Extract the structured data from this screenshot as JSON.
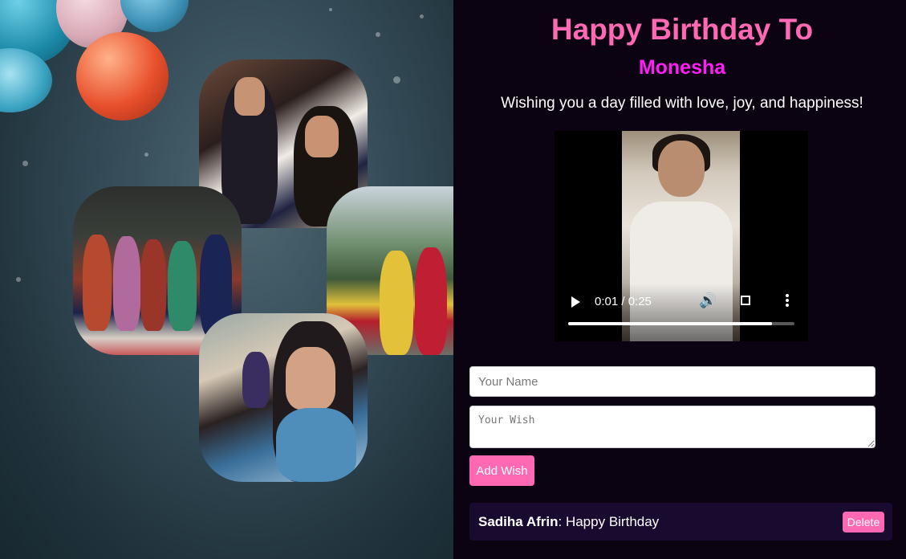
{
  "header": {
    "title": "Happy Birthday To",
    "name": "Monesha",
    "message": "Wishing you a day filled with love, joy, and happiness!"
  },
  "video": {
    "time": "0:01 / 0:25",
    "progress": 0.9
  },
  "form": {
    "name_placeholder": "Your Name",
    "wish_placeholder": "Your Wish",
    "add_label": "Add Wish"
  },
  "wishes": [
    {
      "author": "Sadiha Afrin",
      "text": "Happy Birthday",
      "delete_label": "Delete"
    }
  ],
  "colors": {
    "accent": "#ff69b4",
    "name": "#ff1ff6",
    "background": "#0c0312",
    "wish_item": "#190a30"
  }
}
